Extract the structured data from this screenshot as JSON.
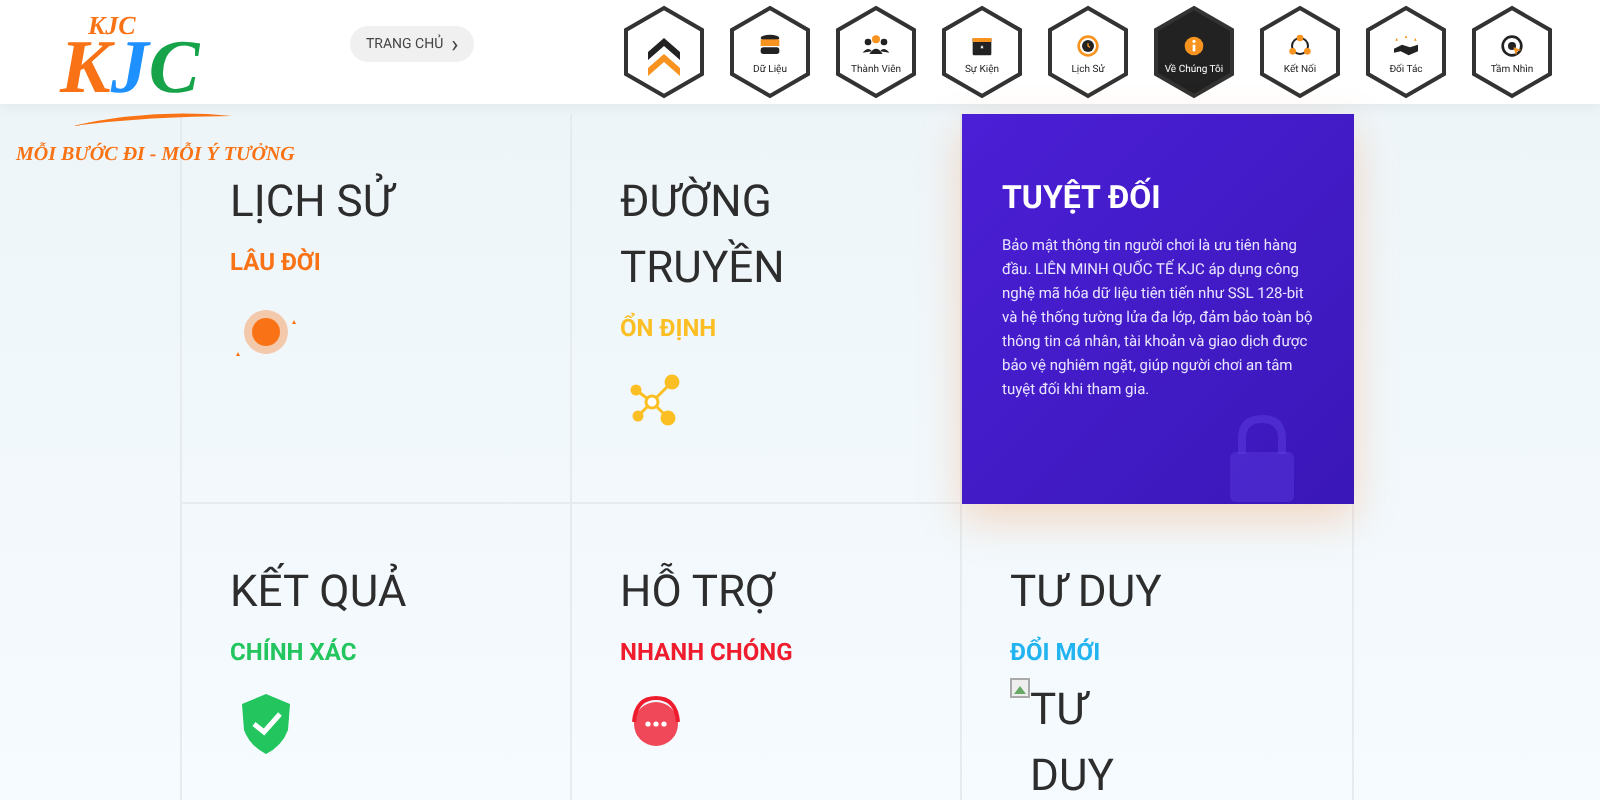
{
  "logo": {
    "small_text": "KJC",
    "letters": [
      "K",
      "J",
      "C"
    ],
    "tagline": "MỖI BƯỚC ĐI - MỖI Ý TƯỞNG"
  },
  "breadcrumb": {
    "label": "TRANG CHỦ",
    "chevron": "›"
  },
  "nav": [
    {
      "selected": false
    },
    {
      "label": "Dữ Liệu",
      "selected": false
    },
    {
      "label": "Thành Viên",
      "selected": false
    },
    {
      "label": "Sự Kiện",
      "selected": false
    },
    {
      "label": "Lịch Sử",
      "selected": false
    },
    {
      "label": "Về Chúng Tôi",
      "selected": true
    },
    {
      "label": "Kết Nối",
      "selected": false
    },
    {
      "label": "Đối Tác",
      "selected": false
    },
    {
      "label": "Tầm Nhìn",
      "selected": false
    }
  ],
  "features": [
    {
      "kind": "feature",
      "title": "LỊCH SỬ",
      "subtitle": "LÂU ĐỜI",
      "color": "#f97316"
    },
    {
      "kind": "feature",
      "title": "ĐƯỜNG TRUYỀN",
      "subtitle": "ỔN ĐỊNH",
      "color": "#fbbf24"
    },
    {
      "kind": "featured",
      "title": "TUYỆT ĐỐI",
      "text": "Bảo mật thông tin người chơi là ưu tiên hàng đầu. LIÊN MINH QUỐC TẾ KJC áp dụng công nghệ mã hóa dữ liệu tiên tiến như SSL 128-bit và hệ thống tường lửa đa lớp, đảm bảo toàn bộ thông tin cá nhân, tài khoản và giao dịch được bảo vệ nghiêm ngặt, giúp người chơi an tâm tuyệt đối khi tham gia."
    },
    {
      "kind": "feature",
      "title": "KẾT QUẢ",
      "subtitle": "CHÍNH XÁC",
      "color": "#22c55e"
    },
    {
      "kind": "feature",
      "title": "HỖ TRỢ",
      "subtitle": "NHANH CHÓNG",
      "color": "#ef1c2e"
    },
    {
      "kind": "broken",
      "title": "TƯ DUY",
      "subtitle": "ĐỔI MỚI",
      "color": "#22b4f0",
      "alt": "TƯ DUY"
    }
  ]
}
